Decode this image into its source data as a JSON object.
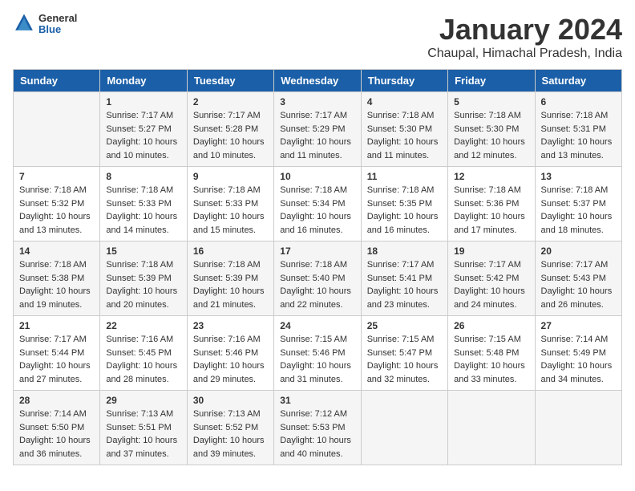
{
  "header": {
    "logo_text_general": "General",
    "logo_text_blue": "Blue",
    "month_year": "January 2024",
    "location": "Chaupal, Himachal Pradesh, India"
  },
  "days_of_week": [
    "Sunday",
    "Monday",
    "Tuesday",
    "Wednesday",
    "Thursday",
    "Friday",
    "Saturday"
  ],
  "weeks": [
    [
      {
        "day": "",
        "info": ""
      },
      {
        "day": "1",
        "info": "Sunrise: 7:17 AM\nSunset: 5:27 PM\nDaylight: 10 hours\nand 10 minutes."
      },
      {
        "day": "2",
        "info": "Sunrise: 7:17 AM\nSunset: 5:28 PM\nDaylight: 10 hours\nand 10 minutes."
      },
      {
        "day": "3",
        "info": "Sunrise: 7:17 AM\nSunset: 5:29 PM\nDaylight: 10 hours\nand 11 minutes."
      },
      {
        "day": "4",
        "info": "Sunrise: 7:18 AM\nSunset: 5:30 PM\nDaylight: 10 hours\nand 11 minutes."
      },
      {
        "day": "5",
        "info": "Sunrise: 7:18 AM\nSunset: 5:30 PM\nDaylight: 10 hours\nand 12 minutes."
      },
      {
        "day": "6",
        "info": "Sunrise: 7:18 AM\nSunset: 5:31 PM\nDaylight: 10 hours\nand 13 minutes."
      }
    ],
    [
      {
        "day": "7",
        "info": "Sunrise: 7:18 AM\nSunset: 5:32 PM\nDaylight: 10 hours\nand 13 minutes."
      },
      {
        "day": "8",
        "info": "Sunrise: 7:18 AM\nSunset: 5:33 PM\nDaylight: 10 hours\nand 14 minutes."
      },
      {
        "day": "9",
        "info": "Sunrise: 7:18 AM\nSunset: 5:33 PM\nDaylight: 10 hours\nand 15 minutes."
      },
      {
        "day": "10",
        "info": "Sunrise: 7:18 AM\nSunset: 5:34 PM\nDaylight: 10 hours\nand 16 minutes."
      },
      {
        "day": "11",
        "info": "Sunrise: 7:18 AM\nSunset: 5:35 PM\nDaylight: 10 hours\nand 16 minutes."
      },
      {
        "day": "12",
        "info": "Sunrise: 7:18 AM\nSunset: 5:36 PM\nDaylight: 10 hours\nand 17 minutes."
      },
      {
        "day": "13",
        "info": "Sunrise: 7:18 AM\nSunset: 5:37 PM\nDaylight: 10 hours\nand 18 minutes."
      }
    ],
    [
      {
        "day": "14",
        "info": "Sunrise: 7:18 AM\nSunset: 5:38 PM\nDaylight: 10 hours\nand 19 minutes."
      },
      {
        "day": "15",
        "info": "Sunrise: 7:18 AM\nSunset: 5:39 PM\nDaylight: 10 hours\nand 20 minutes."
      },
      {
        "day": "16",
        "info": "Sunrise: 7:18 AM\nSunset: 5:39 PM\nDaylight: 10 hours\nand 21 minutes."
      },
      {
        "day": "17",
        "info": "Sunrise: 7:18 AM\nSunset: 5:40 PM\nDaylight: 10 hours\nand 22 minutes."
      },
      {
        "day": "18",
        "info": "Sunrise: 7:17 AM\nSunset: 5:41 PM\nDaylight: 10 hours\nand 23 minutes."
      },
      {
        "day": "19",
        "info": "Sunrise: 7:17 AM\nSunset: 5:42 PM\nDaylight: 10 hours\nand 24 minutes."
      },
      {
        "day": "20",
        "info": "Sunrise: 7:17 AM\nSunset: 5:43 PM\nDaylight: 10 hours\nand 26 minutes."
      }
    ],
    [
      {
        "day": "21",
        "info": "Sunrise: 7:17 AM\nSunset: 5:44 PM\nDaylight: 10 hours\nand 27 minutes."
      },
      {
        "day": "22",
        "info": "Sunrise: 7:16 AM\nSunset: 5:45 PM\nDaylight: 10 hours\nand 28 minutes."
      },
      {
        "day": "23",
        "info": "Sunrise: 7:16 AM\nSunset: 5:46 PM\nDaylight: 10 hours\nand 29 minutes."
      },
      {
        "day": "24",
        "info": "Sunrise: 7:15 AM\nSunset: 5:46 PM\nDaylight: 10 hours\nand 31 minutes."
      },
      {
        "day": "25",
        "info": "Sunrise: 7:15 AM\nSunset: 5:47 PM\nDaylight: 10 hours\nand 32 minutes."
      },
      {
        "day": "26",
        "info": "Sunrise: 7:15 AM\nSunset: 5:48 PM\nDaylight: 10 hours\nand 33 minutes."
      },
      {
        "day": "27",
        "info": "Sunrise: 7:14 AM\nSunset: 5:49 PM\nDaylight: 10 hours\nand 34 minutes."
      }
    ],
    [
      {
        "day": "28",
        "info": "Sunrise: 7:14 AM\nSunset: 5:50 PM\nDaylight: 10 hours\nand 36 minutes."
      },
      {
        "day": "29",
        "info": "Sunrise: 7:13 AM\nSunset: 5:51 PM\nDaylight: 10 hours\nand 37 minutes."
      },
      {
        "day": "30",
        "info": "Sunrise: 7:13 AM\nSunset: 5:52 PM\nDaylight: 10 hours\nand 39 minutes."
      },
      {
        "day": "31",
        "info": "Sunrise: 7:12 AM\nSunset: 5:53 PM\nDaylight: 10 hours\nand 40 minutes."
      },
      {
        "day": "",
        "info": ""
      },
      {
        "day": "",
        "info": ""
      },
      {
        "day": "",
        "info": ""
      }
    ]
  ]
}
